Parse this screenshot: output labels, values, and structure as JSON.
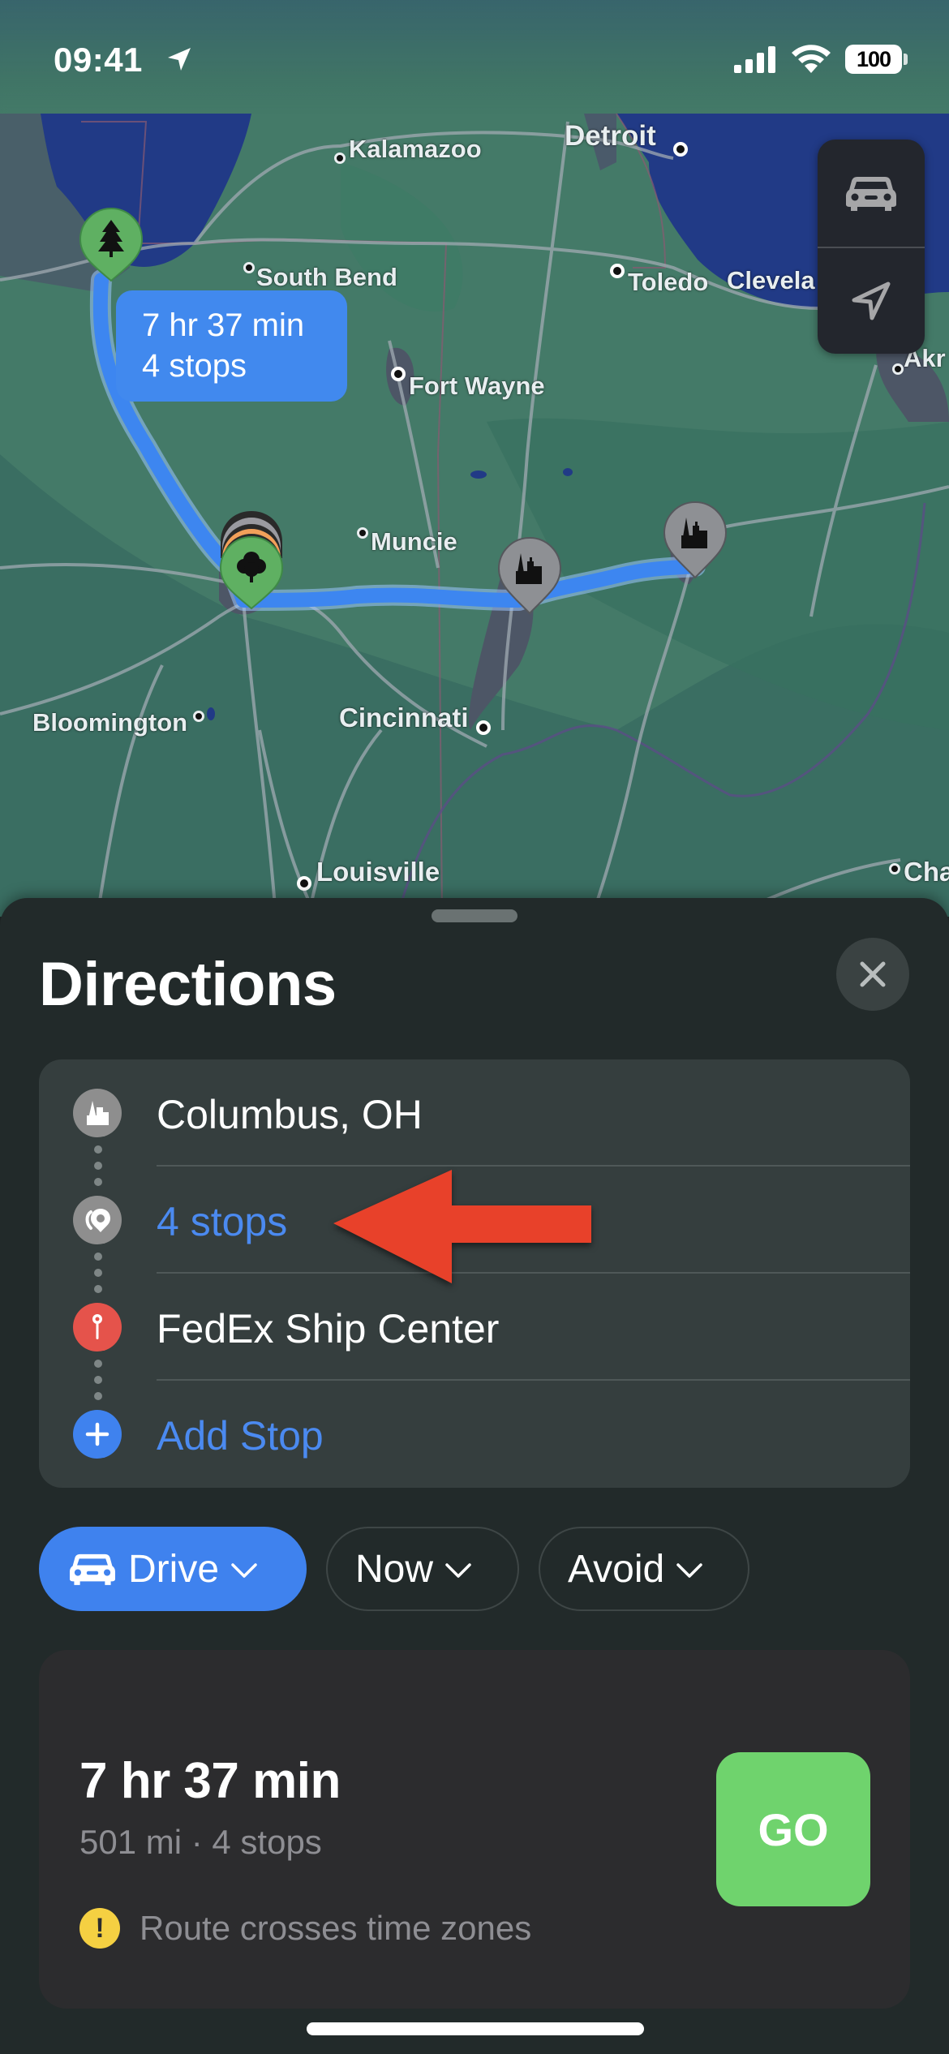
{
  "status_bar": {
    "time": "09:41",
    "battery": "100",
    "icons": [
      "location-arrow-icon",
      "cellular-signal-icon",
      "wifi-icon",
      "battery-icon"
    ]
  },
  "map": {
    "cities": [
      {
        "name": "Kalamazoo"
      },
      {
        "name": "Detroit"
      },
      {
        "name": "South Bend"
      },
      {
        "name": "Toledo"
      },
      {
        "name": "Clevela"
      },
      {
        "name": "Fort Wayne"
      },
      {
        "name": "Akr"
      },
      {
        "name": "Muncie"
      },
      {
        "name": "Bloomington"
      },
      {
        "name": "Cincinnati"
      },
      {
        "name": "Louisville"
      },
      {
        "name": "Cha"
      }
    ],
    "route_callout": {
      "duration": "7 hr 37 min",
      "stops": "4 stops"
    },
    "controls": [
      {
        "icon": "car-icon",
        "label": "Driving map mode"
      },
      {
        "icon": "location-arrow-icon",
        "label": "Current location"
      }
    ],
    "pins": [
      {
        "type": "park",
        "icon": "pine-tree-icon",
        "color": "#5fb062"
      },
      {
        "type": "park",
        "icon": "tree-icon",
        "color": "#5fb062"
      },
      {
        "type": "city",
        "icon": "city-icon",
        "color": "#8e9094"
      },
      {
        "type": "city",
        "icon": "city-icon",
        "color": "#8e9094"
      }
    ],
    "route_color": "#3d86f0"
  },
  "sheet": {
    "title": "Directions",
    "close_label": "Close",
    "waypoints": [
      {
        "label": "Columbus, OH",
        "icon": "city-icon",
        "icon_color": "#8e8e8e",
        "style": "normal"
      },
      {
        "label": "4 stops",
        "icon": "multiple-stops-icon",
        "icon_color": "#8e8e8e",
        "style": "link"
      },
      {
        "label": "FedEx Ship Center",
        "icon": "pin-icon",
        "icon_color": "#e5534b",
        "style": "normal"
      },
      {
        "label": "Add Stop",
        "icon": "plus-icon",
        "icon_color": "#3f82ee",
        "style": "link"
      }
    ],
    "chips": [
      {
        "label": "Drive",
        "icon": "car-icon",
        "selected": true
      },
      {
        "label": "Now",
        "selected": false
      },
      {
        "label": "Avoid",
        "selected": false
      }
    ],
    "route": {
      "duration": "7 hr 37 min",
      "summary": "501 mi · 4 stops",
      "warning": "Route crosses time zones",
      "go_label": "GO"
    }
  },
  "annotation": {
    "type": "arrow",
    "color": "#e8412a",
    "points_to": "4 stops"
  }
}
